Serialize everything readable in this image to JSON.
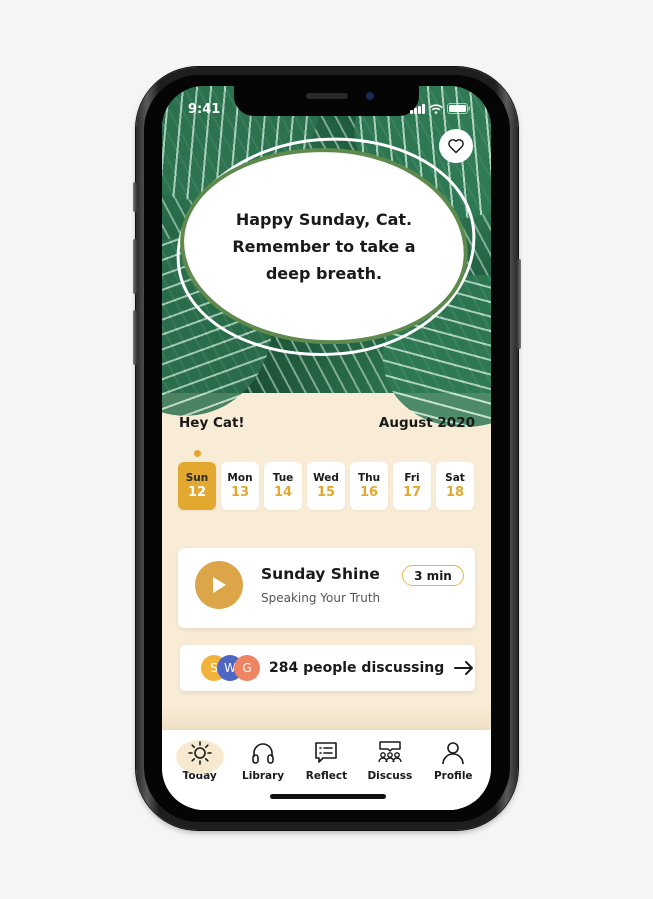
{
  "status_bar": {
    "time": "9:41",
    "icons": [
      "cellular-signal-icon",
      "wifi-icon",
      "battery-icon"
    ]
  },
  "hero": {
    "message": "Happy Sunday, Cat. Remember to take a deep breath.",
    "favorite_icon": "heart-icon"
  },
  "greeting": {
    "hello": "Hey Cat!",
    "month": "August 2020"
  },
  "week": {
    "selected_index": 0,
    "days": [
      {
        "name": "Sun",
        "date": "12"
      },
      {
        "name": "Mon",
        "date": "13"
      },
      {
        "name": "Tue",
        "date": "14"
      },
      {
        "name": "Wed",
        "date": "15"
      },
      {
        "name": "Thu",
        "date": "16"
      },
      {
        "name": "Fri",
        "date": "17"
      },
      {
        "name": "Sat",
        "date": "18"
      }
    ]
  },
  "session": {
    "title": "Sunday Shine",
    "subtitle": "Speaking Your Truth",
    "duration": "3 min",
    "play_icon": "play-icon"
  },
  "discussion": {
    "avatars": [
      {
        "initial": "S",
        "color": "#f1b33c"
      },
      {
        "initial": "W",
        "color": "#4e66c4"
      },
      {
        "initial": "G",
        "color": "#ef8463"
      }
    ],
    "text": "284 people discussing",
    "arrow_icon": "arrow-right-icon"
  },
  "tabbar": {
    "active_index": 0,
    "tabs": [
      {
        "label": "Today",
        "icon": "sun-icon"
      },
      {
        "label": "Library",
        "icon": "headphones-icon"
      },
      {
        "label": "Reflect",
        "icon": "chat-bubble-icon"
      },
      {
        "label": "Discuss",
        "icon": "group-icon"
      },
      {
        "label": "Profile",
        "icon": "person-icon"
      }
    ]
  },
  "colors": {
    "accent": "#e3a830",
    "play_button": "#dba548",
    "background": "#f8ecd6",
    "blob_border": "#5f8a4e"
  }
}
